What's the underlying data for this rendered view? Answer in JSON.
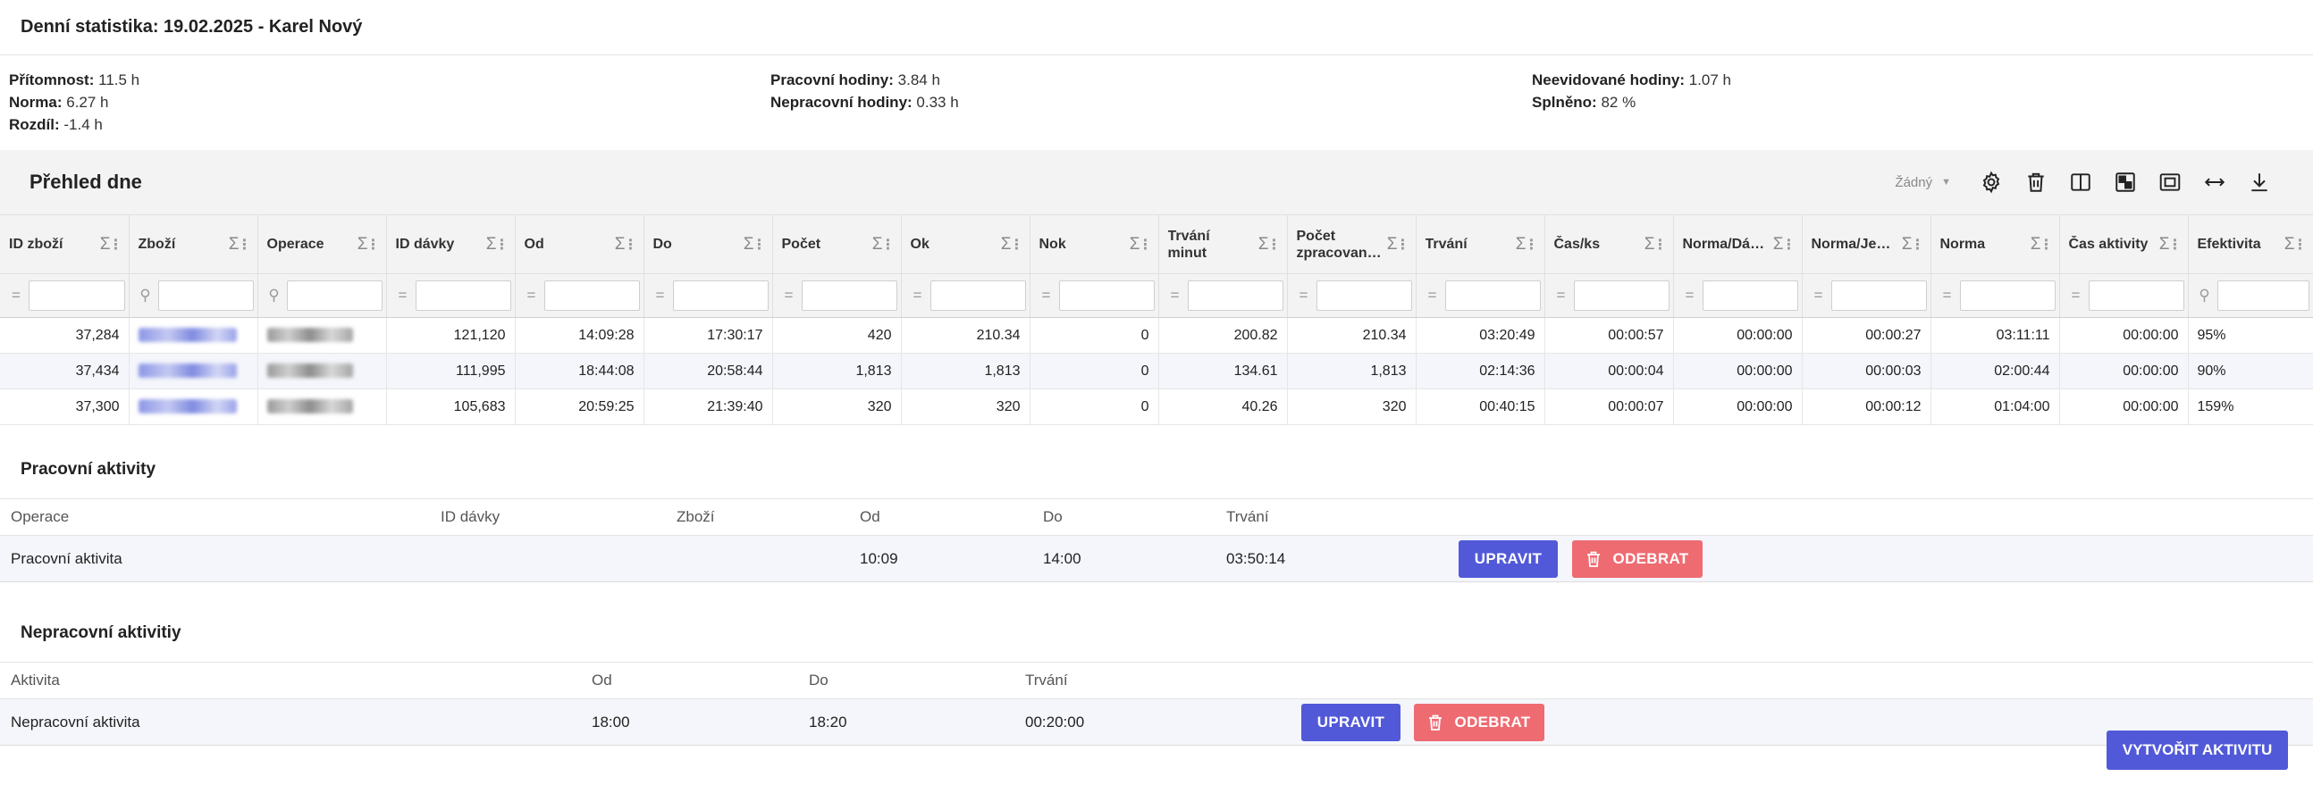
{
  "page": {
    "title": "Denní statistika: 19.02.2025 - Karel Nový"
  },
  "stats": {
    "col1": [
      {
        "label": "Přítomnost:",
        "value": "11.5 h"
      },
      {
        "label": "Norma:",
        "value": "6.27 h"
      },
      {
        "label": "Rozdíl:",
        "value": "-1.4 h"
      }
    ],
    "col2": [
      {
        "label": "Pracovní hodiny:",
        "value": "3.84 h"
      },
      {
        "label": "Nepracovní hodiny:",
        "value": "0.33 h"
      }
    ],
    "col3": [
      {
        "label": "Neevidované hodiny:",
        "value": "1.07 h"
      },
      {
        "label": "Splněno:",
        "value": "82 %"
      }
    ]
  },
  "overview": {
    "title": "Přehled dne",
    "grouping_value": "Žádný",
    "toolbar_icons": [
      "settings-icon",
      "clear-icon",
      "columns-icon",
      "pivot-icon",
      "fullscreen-icon",
      "fit-width-icon",
      "download-icon"
    ],
    "columns": [
      "ID zboží",
      "Zboží",
      "Operace",
      "ID dávky",
      "Od",
      "Do",
      "Počet",
      "Ok",
      "Nok",
      "Trvání minut",
      "Počet zpracovan…",
      "Trvání",
      "Čas/ks",
      "Norma/Dá…",
      "Norma/Je…",
      "Norma",
      "Čas aktivity",
      "Efektivita"
    ],
    "rows": [
      [
        "37,284",
        "",
        "",
        "121,120",
        "14:09:28",
        "17:30:17",
        "420",
        "210.34",
        "0",
        "200.82",
        "210.34",
        "03:20:49",
        "00:00:57",
        "00:00:00",
        "00:00:27",
        "03:11:11",
        "00:00:00",
        "95%"
      ],
      [
        "37,434",
        "",
        "",
        "111,995",
        "18:44:08",
        "20:58:44",
        "1,813",
        "1,813",
        "0",
        "134.61",
        "1,813",
        "02:14:36",
        "00:00:04",
        "00:00:00",
        "00:00:03",
        "02:00:44",
        "00:00:00",
        "90%"
      ],
      [
        "37,300",
        "",
        "",
        "105,683",
        "20:59:25",
        "21:39:40",
        "320",
        "320",
        "0",
        "40.26",
        "320",
        "00:40:15",
        "00:00:07",
        "00:00:00",
        "00:00:12",
        "01:04:00",
        "00:00:00",
        "159%"
      ]
    ]
  },
  "work_activities": {
    "title": "Pracovní aktivity",
    "headers": {
      "operation": "Operace",
      "batch_id": "ID dávky",
      "goods": "Zboží",
      "from": "Od",
      "to": "Do",
      "duration": "Trvání"
    },
    "rows": [
      {
        "operation": "Pracovní aktivita",
        "batch_id": "",
        "goods": "",
        "from": "10:09",
        "to": "14:00",
        "duration": "03:50:14"
      }
    ]
  },
  "nonwork_activities": {
    "title": "Nepracovní aktivitiy",
    "headers": {
      "activity": "Aktivita",
      "from": "Od",
      "to": "Do",
      "duration": "Trvání"
    },
    "rows": [
      {
        "activity": "Nepracovní aktivita",
        "from": "18:00",
        "to": "18:20",
        "duration": "00:20:00"
      }
    ]
  },
  "buttons": {
    "edit": "UPRAVIT",
    "remove": "ODEBRAT",
    "create": "VYTVOŘIT AKTIVITU"
  },
  "colors": {
    "primary": "#5159d8",
    "danger": "#ee6b72",
    "header_bg": "#f3f3f3",
    "row_alt": "#f4f6fb"
  }
}
